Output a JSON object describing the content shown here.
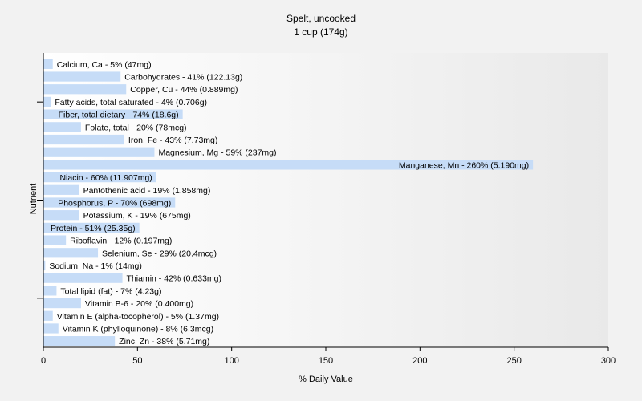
{
  "chart_data": {
    "type": "bar",
    "orientation": "horizontal",
    "title": "Spelt, uncooked",
    "subtitle": "1 cup (174g)",
    "xlabel": "% Daily Value",
    "ylabel": "Nutrient",
    "xlim": [
      0,
      300
    ],
    "xticks": [
      "0",
      "50",
      "100",
      "150",
      "200",
      "250",
      "300"
    ],
    "bar_color": "#c6dcf7",
    "grid": false,
    "categories": [
      "Calcium, Ca - 5% (47mg)",
      "Carbohydrates - 41% (122.13g)",
      "Copper, Cu - 44% (0.889mg)",
      "Fatty acids, total saturated - 4% (0.706g)",
      "Fiber, total dietary - 74% (18.6g)",
      "Folate, total - 20% (78mcg)",
      "Iron, Fe - 43% (7.73mg)",
      "Magnesium, Mg - 59% (237mg)",
      "Manganese, Mn - 260% (5.190mg)",
      "Niacin - 60% (11.907mg)",
      "Pantothenic acid - 19% (1.858mg)",
      "Phosphorus, P - 70% (698mg)",
      "Potassium, K - 19% (675mg)",
      "Protein - 51% (25.35g)",
      "Riboflavin - 12% (0.197mg)",
      "Selenium, Se - 29% (20.4mcg)",
      "Sodium, Na - 1% (14mg)",
      "Thiamin - 42% (0.633mg)",
      "Total lipid (fat) - 7% (4.23g)",
      "Vitamin B-6 - 20% (0.400mg)",
      "Vitamin E (alpha-tocopherol) - 5% (1.37mg)",
      "Vitamin K (phylloquinone) - 8% (6.3mcg)",
      "Zinc, Zn - 38% (5.71mg)"
    ],
    "values": [
      5,
      41,
      44,
      4,
      74,
      20,
      43,
      59,
      260,
      60,
      19,
      70,
      19,
      51,
      12,
      29,
      1,
      42,
      7,
      20,
      5,
      8,
      38
    ]
  }
}
